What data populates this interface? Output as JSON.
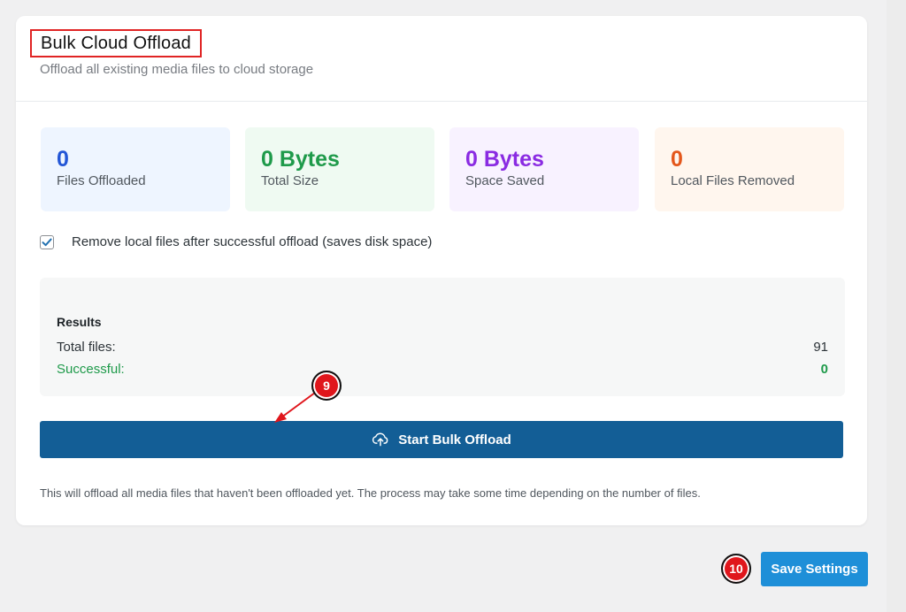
{
  "header": {
    "title": "Bulk Cloud Offload",
    "subtitle": "Offload all existing media files to cloud storage"
  },
  "stats": [
    {
      "value": "0",
      "label": "Files Offloaded"
    },
    {
      "value": "0 Bytes",
      "label": "Total Size"
    },
    {
      "value": "0 Bytes",
      "label": "Space Saved"
    },
    {
      "value": "0",
      "label": "Local Files Removed"
    }
  ],
  "option": {
    "label": "Remove local files after successful offload (saves disk space)",
    "checked": true
  },
  "results": {
    "title": "Results",
    "rows": [
      {
        "label": "Total files:",
        "value": "91"
      },
      {
        "label": "Successful:",
        "value": "0"
      }
    ]
  },
  "actions": {
    "start_label": "Start Bulk Offload",
    "start_icon": "cloud-upload-icon",
    "note": "This will offload all media files that haven't been offloaded yet. The process may take some time depending on the number of files.",
    "save_label": "Save Settings"
  },
  "annotations": {
    "step_9": "9",
    "step_10": "10"
  },
  "colors": {
    "primary_button": "#135e96",
    "save_button": "#1e8fd8",
    "highlight": "#e02424"
  }
}
